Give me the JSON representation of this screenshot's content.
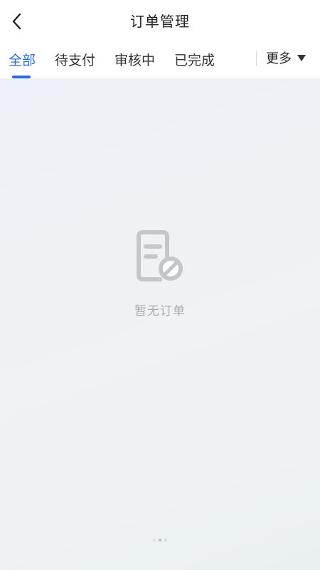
{
  "header": {
    "title": "订单管理",
    "back_icon": "chevron-left-icon"
  },
  "tabs": {
    "items": [
      {
        "label": "全部",
        "active": true
      },
      {
        "label": "待支付",
        "active": false
      },
      {
        "label": "审核中",
        "active": false
      },
      {
        "label": "已完成",
        "active": false
      }
    ],
    "more_label": "更多",
    "more_icon": "caret-down-icon"
  },
  "empty_state": {
    "icon": "empty-order-icon",
    "text": "暂无订单"
  },
  "colors": {
    "accent": "#2f6bd8",
    "text_primary": "#222222",
    "empty_text": "#a8abb2"
  }
}
